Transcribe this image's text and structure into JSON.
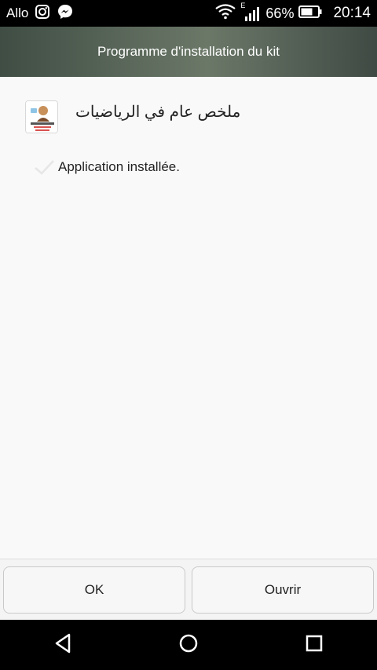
{
  "status_bar": {
    "carrier": "Allo",
    "battery": "66%",
    "time": "20:14",
    "network_letter": "E",
    "icons": [
      "instagram-icon",
      "messenger-icon",
      "wifi-icon",
      "signal-icon",
      "battery-icon"
    ]
  },
  "header": {
    "title": "Programme d'installation du kit"
  },
  "app": {
    "name": "ملخص عام في الرياضيات",
    "icon": "app-icon"
  },
  "install_status": {
    "text": "Application installée.",
    "icon": "check-icon"
  },
  "buttons": {
    "ok_label": "OK",
    "open_label": "Ouvrir"
  },
  "nav": {
    "icons": [
      "back-icon",
      "home-icon",
      "recents-icon"
    ]
  },
  "colors": {
    "title_bar": "#5a6a5d",
    "background": "#f9f9f9",
    "nav_bar": "#000000"
  }
}
